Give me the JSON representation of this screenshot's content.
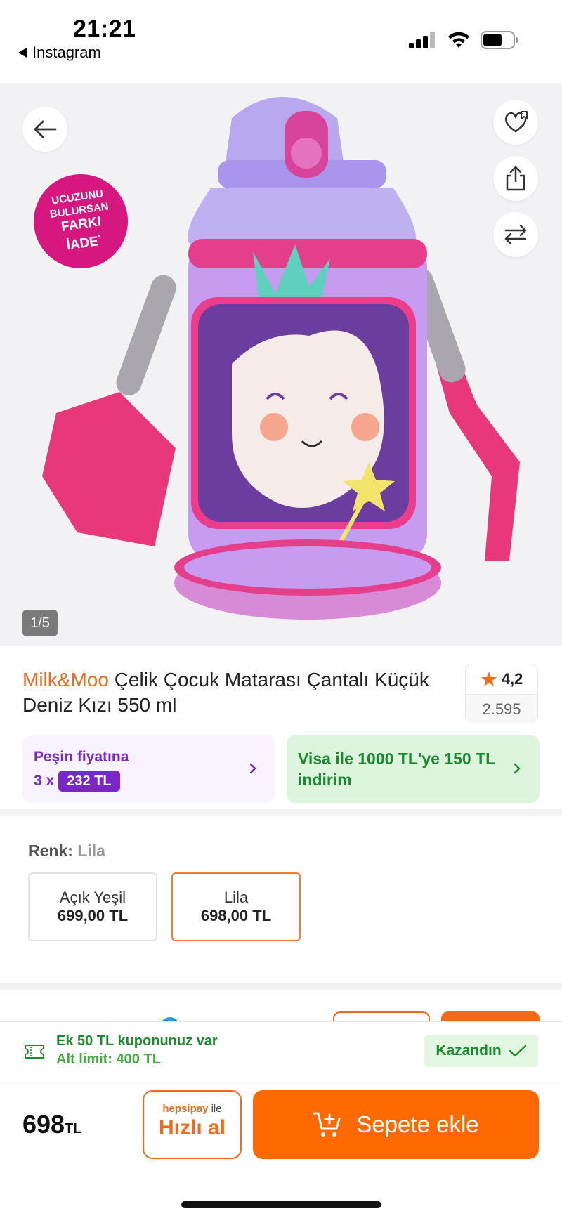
{
  "status_bar": {
    "time": "21:21",
    "back_app": "Instagram"
  },
  "gallery": {
    "badge_lines": [
      "UCUZUNU",
      "BULURSAN",
      "FARKI",
      "İADE"
    ],
    "badge_mark": "*",
    "counter": "1/5",
    "icons": [
      "back-arrow-icon",
      "heart-list-icon",
      "share-icon",
      "compare-icon"
    ]
  },
  "product": {
    "brand": "Milk&Moo",
    "title": "Çelik Çocuk Matarası Çantalı Küçük Deniz Kızı 550 ml",
    "rating": "4,2",
    "review_count": "2.595"
  },
  "offers": {
    "installment_label": "Peşin fiyatına",
    "installment_count": "3 x",
    "installment_amount": "232 TL",
    "visa_text": "Visa ile 1000 TL'ye 150 TL indirim"
  },
  "variants": {
    "label": "Renk:",
    "selected": "Lila",
    "options": [
      {
        "name": "Açık Yeşil",
        "price": "699,00 TL"
      },
      {
        "name": "Lila",
        "price": "698,00 TL"
      }
    ]
  },
  "coupon": {
    "title": "Ek 50 TL kuponunuz var",
    "limit": "Alt limit: 400 TL",
    "status": "Kazandın"
  },
  "action_bar": {
    "price": "698",
    "currency": "TL",
    "quick_brand": "hepsipay",
    "quick_ile": "ile",
    "quick_label": "Hızlı al",
    "add_to_cart": "Sepete ekle"
  },
  "colors": {
    "accent": "#ff6a00",
    "purple": "#7b26c9",
    "green": "#1a8a2e",
    "badge": "#d6177f"
  }
}
